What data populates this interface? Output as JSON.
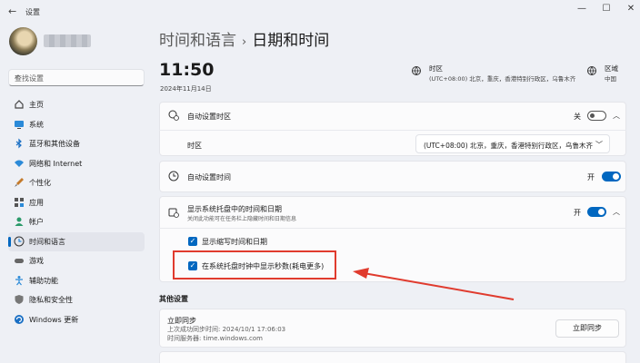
{
  "window": {
    "back_glyph": "←",
    "title": "设置",
    "minimize_glyph": "—",
    "maximize_glyph": "☐",
    "close_glyph": "✕"
  },
  "search": {
    "placeholder": "查找设置",
    "icon": "search-icon"
  },
  "sidebar": {
    "items": [
      {
        "label": "主页",
        "icon": "home-icon"
      },
      {
        "label": "系统",
        "icon": "system-icon"
      },
      {
        "label": "蓝牙和其他设备",
        "icon": "bluetooth-icon"
      },
      {
        "label": "网络和 Internet",
        "icon": "wifi-icon"
      },
      {
        "label": "个性化",
        "icon": "brush-icon"
      },
      {
        "label": "应用",
        "icon": "apps-icon"
      },
      {
        "label": "帐户",
        "icon": "account-icon"
      },
      {
        "label": "时间和语言",
        "icon": "time-language-icon",
        "active": true
      },
      {
        "label": "游戏",
        "icon": "gaming-icon"
      },
      {
        "label": "辅助功能",
        "icon": "accessibility-icon"
      },
      {
        "label": "隐私和安全性",
        "icon": "shield-icon"
      },
      {
        "label": "Windows 更新",
        "icon": "windows-update-icon"
      }
    ]
  },
  "breadcrumb": {
    "parent": "时间和语言",
    "separator": "›",
    "current": "日期和时间"
  },
  "clock": {
    "time": "11:50",
    "date": "2024年11月14日"
  },
  "timezone_info": {
    "label": "时区",
    "value": "(UTC+08:00) 北京，重庆，香港特别行政区，乌鲁木齐"
  },
  "region_info": {
    "label": "区域",
    "value": "中国"
  },
  "settings": {
    "auto_timezone": {
      "label": "自动设置时区",
      "state": "关",
      "on": false
    },
    "timezone_row": {
      "label": "时区",
      "value": "(UTC+08:00) 北京，重庆，香港特别行政区，乌鲁木齐"
    },
    "auto_time": {
      "label": "自动设置时间",
      "state": "开",
      "on": true
    },
    "tray_time": {
      "label": "显示系统托盘中的时间和日期",
      "sublabel": "关闭此功能可在任务栏上隐藏时间和日期信息",
      "state": "开",
      "on": true
    },
    "show_short": {
      "label": "显示缩写时间和日期",
      "checked": true
    },
    "show_seconds": {
      "label": "在系统托盘时钟中显示秒数(耗电更多)",
      "checked": true
    }
  },
  "other": {
    "heading": "其他设置",
    "sync_title": "立即同步",
    "last_sync": "上次成功同步时间: 2024/10/1 17:06:03",
    "server": "时间服务器: time.windows.com",
    "sync_button": "立即同步"
  },
  "colors": {
    "accent": "#0067c0",
    "annotation": "#e03b2e"
  }
}
